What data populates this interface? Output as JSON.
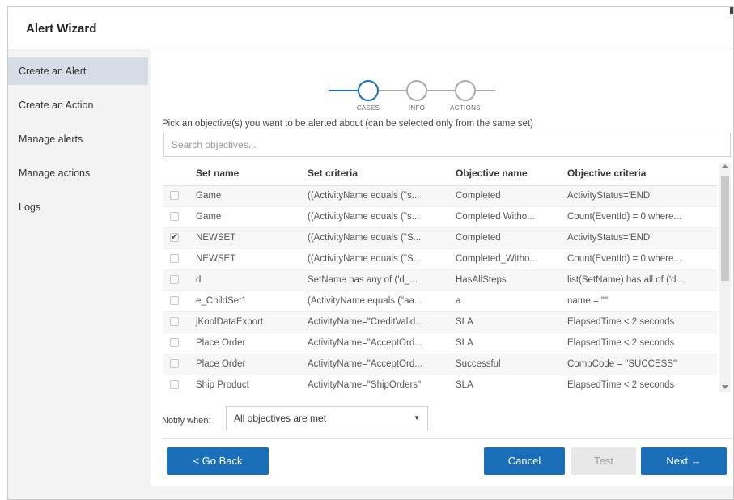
{
  "window": {
    "title": "Alert Wizard"
  },
  "sidebar": {
    "items": [
      {
        "label": "Create an Alert",
        "active": true
      },
      {
        "label": "Create an Action",
        "active": false
      },
      {
        "label": "Manage alerts",
        "active": false
      },
      {
        "label": "Manage actions",
        "active": false
      },
      {
        "label": "Logs",
        "active": false
      }
    ]
  },
  "stepper": {
    "steps": [
      {
        "label": "CASES",
        "state": "current"
      },
      {
        "label": "INFO",
        "state": "pending"
      },
      {
        "label": "ACTIONS",
        "state": "pending"
      }
    ],
    "active_color": "#1a6fb8",
    "pending_color": "#aaaaaa"
  },
  "main": {
    "instruction": "Pick an objective(s) you want to be alerted about (can be selected only from the same set)",
    "search": {
      "placeholder": "Search objectives...",
      "value": ""
    },
    "table": {
      "columns": [
        "Set name",
        "Set criteria",
        "Objective name",
        "Objective criteria"
      ],
      "rows": [
        {
          "checked": false,
          "set_name": "Game",
          "set_criteria": "((ActivityName equals (\"s...",
          "objective_name": "Completed",
          "objective_criteria": "ActivityStatus='END'"
        },
        {
          "checked": false,
          "set_name": "Game",
          "set_criteria": "((ActivityName equals (\"s...",
          "objective_name": "Completed Witho...",
          "objective_criteria": "Count(EventId) = 0 where..."
        },
        {
          "checked": true,
          "set_name": "NEWSET",
          "set_criteria": "((ActivityName equals (\"S...",
          "objective_name": "Completed",
          "objective_criteria": "ActivityStatus='END'"
        },
        {
          "checked": false,
          "set_name": "NEWSET",
          "set_criteria": "((ActivityName equals (\"S...",
          "objective_name": "Completed_Witho...",
          "objective_criteria": "Count(EventId) = 0 where..."
        },
        {
          "checked": false,
          "set_name": "d",
          "set_criteria": "SetName has any of ('d_...",
          "objective_name": "HasAllSteps",
          "objective_criteria": "list(SetName) has all of ('d..."
        },
        {
          "checked": false,
          "set_name": "e_ChildSet1",
          "set_criteria": "(ActivityName equals (\"aa...",
          "objective_name": "a",
          "objective_criteria": "name = \"\""
        },
        {
          "checked": false,
          "set_name": "jKoolDataExport",
          "set_criteria": "ActivityName=\"CreditValid...",
          "objective_name": "SLA",
          "objective_criteria": "ElapsedTime < 2 seconds"
        },
        {
          "checked": false,
          "set_name": "Place Order",
          "set_criteria": "ActivityName=\"AcceptOrd...",
          "objective_name": "SLA",
          "objective_criteria": "ElapsedTime < 2 seconds"
        },
        {
          "checked": false,
          "set_name": "Place Order",
          "set_criteria": "ActivityName=\"AcceptOrd...",
          "objective_name": "Successful",
          "objective_criteria": "CompCode = \"SUCCESS\""
        },
        {
          "checked": false,
          "set_name": "Ship Product",
          "set_criteria": "ActivityName=\"ShipOrders\"",
          "objective_name": "SLA",
          "objective_criteria": "ElapsedTime < 2 seconds"
        }
      ]
    },
    "notify": {
      "label": "Notify when:",
      "value": "All objectives are met"
    }
  },
  "footer": {
    "back_label": "< Go Back",
    "cancel_label": "Cancel",
    "test_label": "Test",
    "next_label": "Next →"
  },
  "colors": {
    "primary_button": "#1a6fb8",
    "sidebar_active": "#d7dde7",
    "disabled_button": "#e8e8e8"
  }
}
